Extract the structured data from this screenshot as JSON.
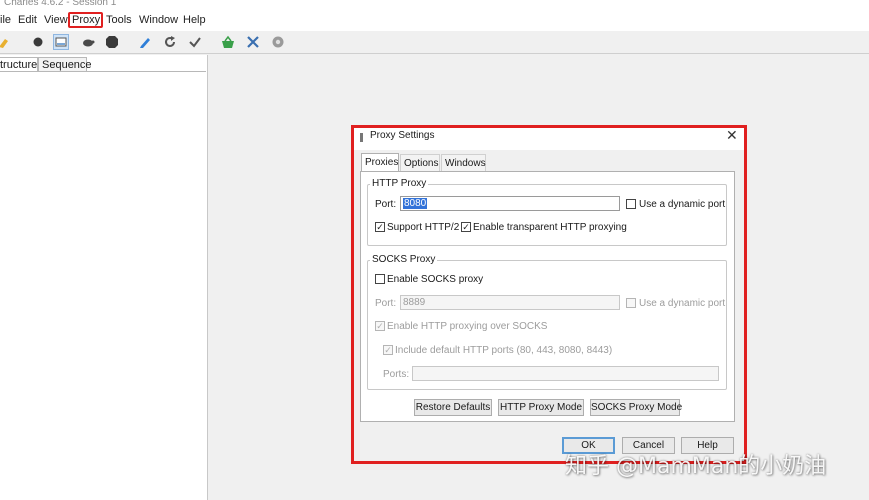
{
  "window": {
    "title": "Charles 4.6.2 - Session 1"
  },
  "menu": [
    "ile",
    "Edit",
    "View",
    "Proxy",
    "Tools",
    "Window",
    "Help"
  ],
  "toolbar": {
    "icons": [
      "broom-icon",
      "record-icon",
      "throttle-icon",
      "turtle-icon",
      "breakpoint-icon",
      "pen-icon",
      "refresh-icon",
      "check-icon",
      "basket-icon",
      "tools-icon",
      "settings-icon"
    ]
  },
  "panes": {
    "tabs": [
      "tructure",
      "Sequence"
    ]
  },
  "dialog": {
    "title": "Proxy Settings",
    "close": "✕",
    "tabs": [
      "Proxies",
      "Options",
      "Windows"
    ],
    "http": {
      "group": "HTTP Proxy",
      "port_label": "Port:",
      "port": "8080",
      "dynamic_port": "Use a dynamic port",
      "support_http2": "Support HTTP/2",
      "transparent": "Enable transparent HTTP proxying",
      "checked": {
        "dynamic_port": false,
        "support_http2": true,
        "transparent": true
      }
    },
    "socks": {
      "group": "SOCKS Proxy",
      "enable": "Enable SOCKS proxy",
      "port_label": "Port:",
      "port": "8889",
      "dynamic_port": "Use a dynamic port",
      "http_over_socks": "Enable HTTP proxying over SOCKS",
      "include_default": "Include default HTTP ports (80, 443, 8080, 8443)",
      "ports_label": "Ports:",
      "ports": "",
      "checked": {
        "enable": false,
        "dynamic_port": false,
        "http_over_socks": true,
        "include_default": true
      }
    },
    "buttons": {
      "restore": "Restore Defaults",
      "http_mode": "HTTP Proxy Mode",
      "socks_mode": "SOCKS Proxy Mode",
      "ok": "OK",
      "cancel": "Cancel",
      "help": "Help"
    }
  },
  "watermark": "知乎 @MamMan的小奶油",
  "colors": {
    "highlight": "#e02020",
    "selection": "#3373d9",
    "ok_border": "#5b9bd5"
  },
  "glyphs": {
    "check": "✓"
  }
}
